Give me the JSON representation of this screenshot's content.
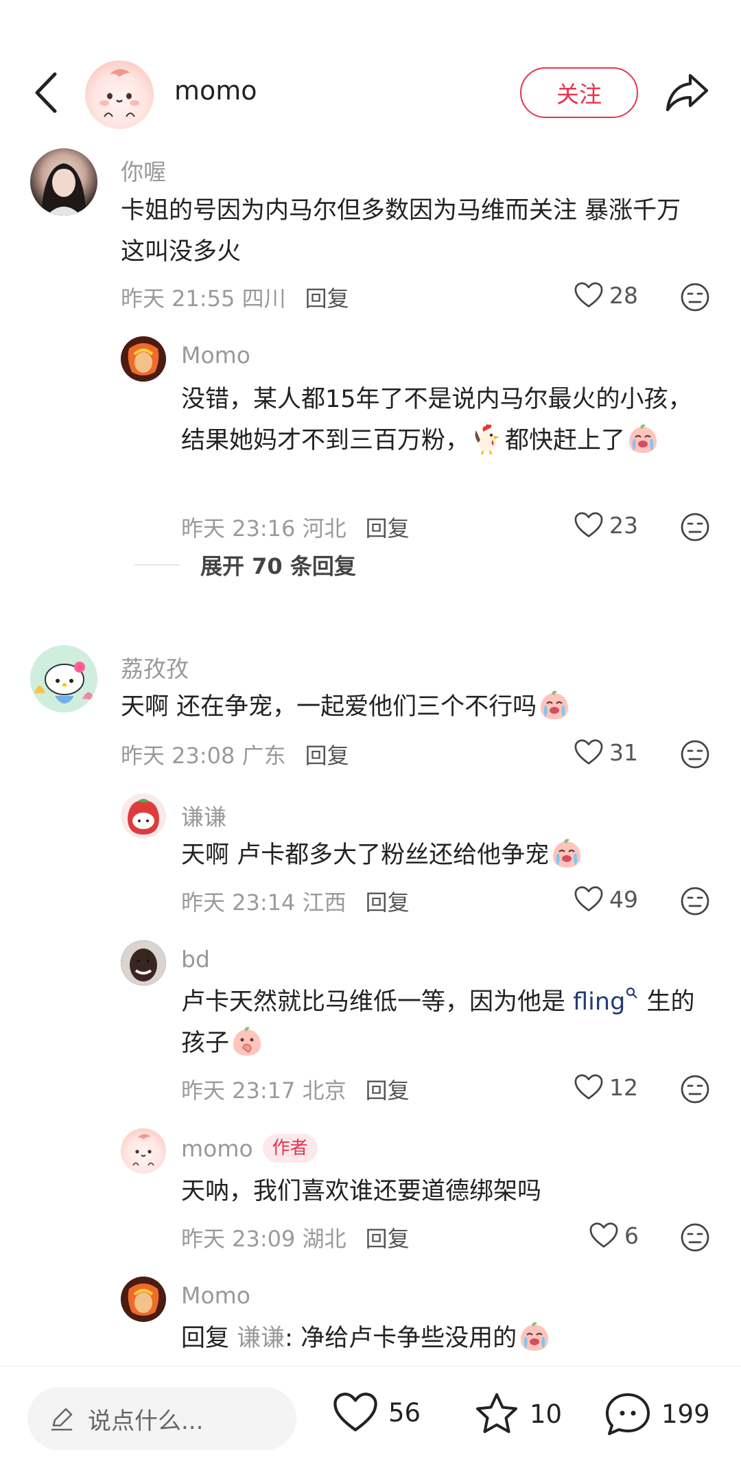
{
  "header": {
    "author_name": "momo",
    "follow_label": "关注"
  },
  "comments": [
    {
      "name": "你喔",
      "text": "卡姐的号因为内马尔但多数因为马维而关注 暴涨千万 这叫没多火",
      "time": "昨天 21:55 四川",
      "reply_label": "回复",
      "likes": "28"
    },
    {
      "name": "Momo",
      "text_a": "没错，某人都15年了不是说内马尔最火的小孩，结果她妈才不到三百万粉，",
      "text_b": "都快赶上了",
      "time": "昨天 23:16 河北",
      "reply_label": "回复",
      "likes": "23"
    },
    {
      "name": "荔孜孜",
      "text": "天啊 还在争宠，一起爱他们三个不行吗",
      "time": "昨天 23:08 广东",
      "reply_label": "回复",
      "likes": "31"
    },
    {
      "name": "谦谦",
      "text": "天啊 卢卡都多大了粉丝还给他争宠",
      "time": "昨天 23:14 江西",
      "reply_label": "回复",
      "likes": "49"
    },
    {
      "name": "bd",
      "text_a": "卢卡天然就比马维低一等，因为他是 ",
      "link": "fling",
      "text_b": " 生的孩子",
      "time": "昨天 23:17 北京",
      "reply_label": "回复",
      "likes": "12"
    },
    {
      "name": "momo",
      "author_tag": "作者",
      "text": "天呐，我们喜欢谁还要道德绑架吗",
      "time": "昨天 23:09 湖北",
      "reply_label": "回复",
      "likes": "6"
    },
    {
      "name": "Momo",
      "reply_prefix": "回复 ",
      "reply_to": "谦谦",
      "text": ": 净给卢卡争些没用的"
    }
  ],
  "expand_label": "展开 70 条回复",
  "bottom_bar": {
    "input_placeholder": "说点什么...",
    "like_count": "56",
    "star_count": "10",
    "comment_count": "199"
  },
  "colors": {
    "accent": "#e8334d",
    "meta": "#999999",
    "link": "#233b70"
  }
}
